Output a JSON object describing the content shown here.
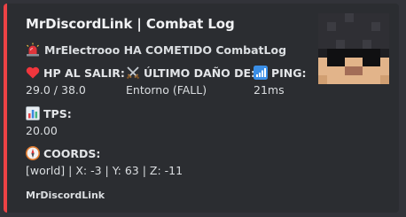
{
  "embed": {
    "accent_color": "#ed4245",
    "title": "MrDiscordLink | Combat Log",
    "description": "MrElectrooo HA COMETIDO CombatLog",
    "description_icon": "rotating-light-icon",
    "fields": [
      {
        "icon": "red-heart-icon",
        "name": "HP AL SALIR:",
        "value": "29.0 / 38.0"
      },
      {
        "icon": "crossed-swords-icon",
        "name": "ÚLTIMO DAÑO DE:",
        "value": "Entorno (FALL)"
      },
      {
        "icon": "signal-bars-icon",
        "name": "PING:",
        "value": "21ms"
      },
      {
        "icon": "bar-chart-icon",
        "name": "TPS:",
        "value": "20.00"
      },
      {
        "icon": "compass-icon",
        "name": "COORDS:",
        "value": "[world] | X: -3 | Y: 63 | Z: -11"
      }
    ],
    "footer": "MrDiscordLink",
    "thumbnail_icon": "minecraft-skin-face-icon"
  }
}
